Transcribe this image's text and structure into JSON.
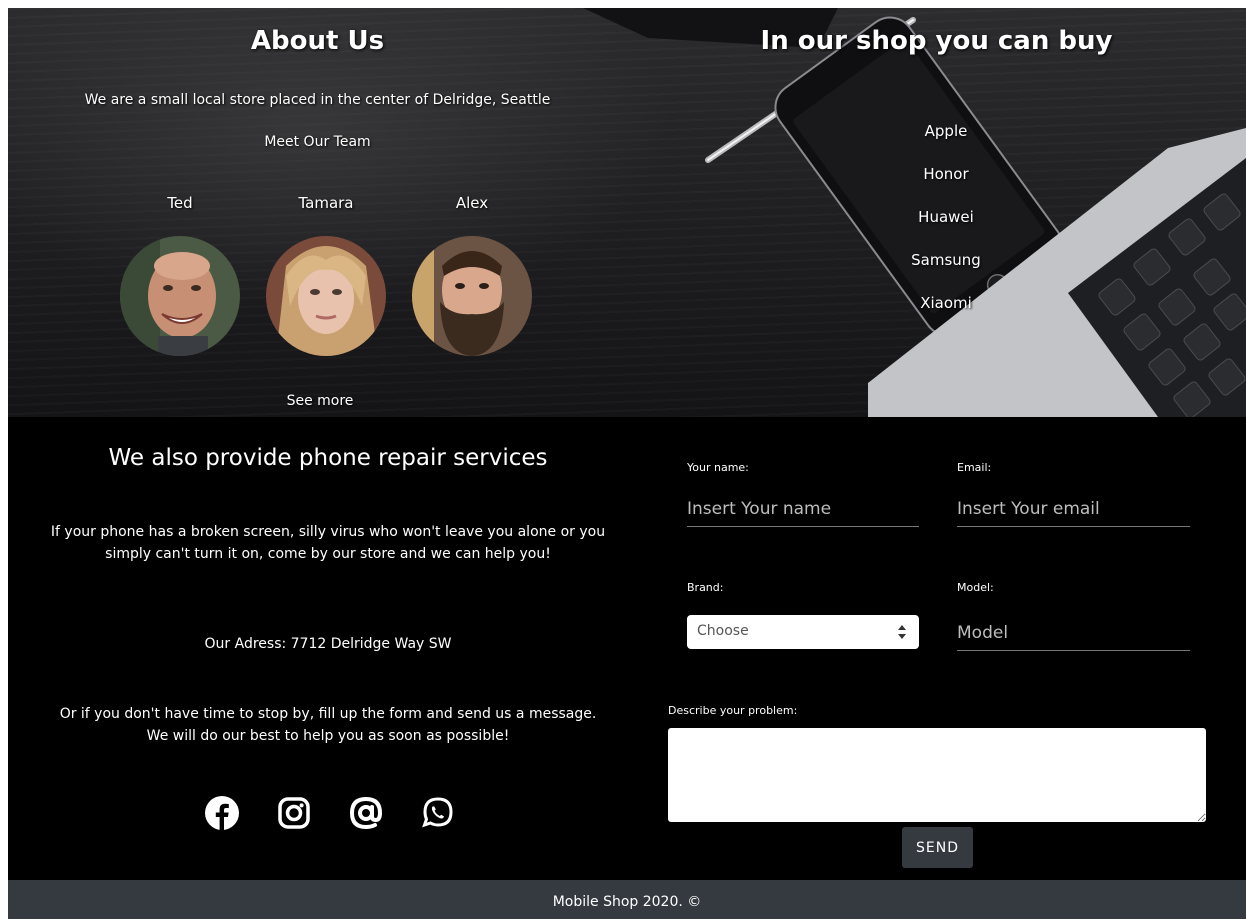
{
  "about": {
    "title": "About Us",
    "text": "We are a small local store placed in the center of Delridge, Seattle",
    "team_title": "Meet Our Team",
    "members": [
      {
        "name": "Ted"
      },
      {
        "name": "Tamara"
      },
      {
        "name": "Alex"
      }
    ],
    "see_more": "See more"
  },
  "shop": {
    "title": "In our shop you can buy",
    "brands": [
      "Apple",
      "Honor",
      "Huawei",
      "Samsung",
      "Xiaomi"
    ]
  },
  "repair": {
    "title": "We also provide phone repair services",
    "paragraph1": "If your phone has a broken screen, silly virus who won't leave you alone or you simply can't turn it on, come by our store and we can help you!",
    "address": "Our Adress: 7712 Delridge Way SW",
    "paragraph2": "Or if you don't have time to stop by, fill up the form and send us a message. We will do our best to help you as soon as possible!",
    "social_icons": [
      "facebook-icon",
      "instagram-icon",
      "email-at-icon",
      "whatsapp-icon"
    ]
  },
  "form": {
    "name_label": "Your name:",
    "name_placeholder": "Insert Your name",
    "email_label": "Email:",
    "email_placeholder": "Insert Your email",
    "brand_label": "Brand:",
    "brand_selected": "Choose",
    "model_label": "Model:",
    "model_placeholder": "Model",
    "problem_label": "Describe your problem:",
    "send_label": "SEND"
  },
  "footer": {
    "text": "Mobile Shop 2020. ©"
  },
  "colors": {
    "footer_bg": "#343a40",
    "section_bg": "#000000",
    "button_bg": "#343a40"
  }
}
